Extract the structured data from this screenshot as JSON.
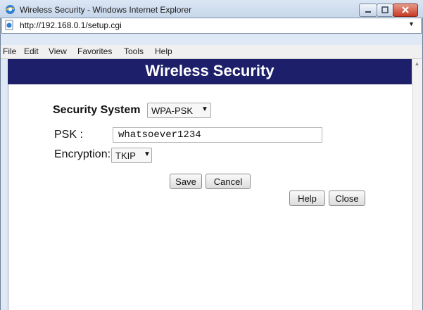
{
  "window": {
    "title": "Wireless Security - Windows Internet Explorer"
  },
  "address_bar": {
    "url": "http://192.168.0.1/setup.cgi"
  },
  "menu": [
    "File",
    "Edit",
    "View",
    "Favorites",
    "Tools",
    "Help"
  ],
  "page": {
    "title": "Wireless Security",
    "security_system": {
      "label": "Security System",
      "value": "WPA-PSK"
    },
    "psk": {
      "label": "PSK :",
      "value": "whatsoever1234"
    },
    "encryption": {
      "label": "Encryption:",
      "value": "TKIP"
    },
    "buttons": {
      "save": "Save",
      "cancel": "Cancel",
      "help": "Help",
      "close": "Close"
    }
  },
  "colors": {
    "header_bg": "#1d1f6b",
    "header_text": "#ffffff"
  },
  "icons": [
    "ie-logo-icon",
    "page-icon",
    "minimize-icon",
    "maximize-icon",
    "close-icon",
    "dropdown-arrow-icon",
    "scroll-up-icon"
  ]
}
